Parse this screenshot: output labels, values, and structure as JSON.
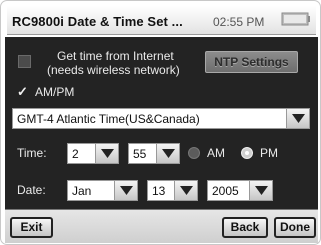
{
  "window": {
    "title": "RC9800i Date & Time Set ...",
    "clock": "02:55 PM"
  },
  "internet_time": {
    "label_line1": "Get time from Internet",
    "label_line2": "(needs wireless network)",
    "checked": false,
    "ntp_button_label": "NTP Settings"
  },
  "ampm": {
    "label": "AM/PM",
    "checked": true
  },
  "timezone": {
    "value": "GMT-4 Atlantic Time(US&Canada)"
  },
  "time": {
    "label": "Time:",
    "hour": "2",
    "minute": "55",
    "am_label": "AM",
    "pm_label": "PM",
    "selected_period": "PM"
  },
  "date": {
    "label": "Date:",
    "month": "Jan",
    "day": "13",
    "year": "2005"
  },
  "bottom_bar": {
    "exit_label": "Exit",
    "back_label": "Back",
    "done_label": "Done"
  },
  "colors": {
    "panel": "#232323",
    "bar": "#d8d8d8"
  }
}
